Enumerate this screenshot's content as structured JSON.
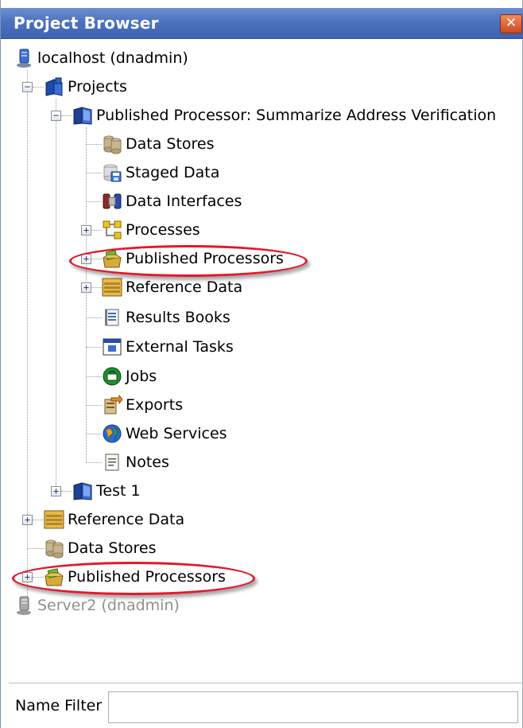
{
  "window": {
    "title": "Project Browser",
    "close_glyph": "✕"
  },
  "tree": {
    "server": "localhost (dnadmin)",
    "projects": "Projects",
    "published_processor": "Published Processor: Summarize Address Verification",
    "data_stores": "Data Stores",
    "staged_data": "Staged Data",
    "data_interfaces": "Data Interfaces",
    "processes": "Processes",
    "published_processors": "Published Processors",
    "reference_data": "Reference Data",
    "results_books": "Results Books",
    "external_tasks": "External Tasks",
    "jobs": "Jobs",
    "exports": "Exports",
    "web_services": "Web Services",
    "notes": "Notes",
    "test1": "Test 1",
    "root_reference_data": "Reference Data",
    "root_data_stores": "Data Stores",
    "root_published_processors": "Published Processors",
    "server2": "Server2 (dnadmin)"
  },
  "filter": {
    "label": "Name Filter",
    "value": "",
    "placeholder": ""
  },
  "colors": {
    "titlebar": "#4d72bf",
    "highlight": "#e2182a",
    "disabled_text": "#8f8f8f"
  },
  "icons": [
    "server-icon",
    "projects-icon",
    "book-icon",
    "database-icon",
    "staged-data-icon",
    "data-interfaces-icon",
    "processes-icon",
    "published-processor-icon",
    "reference-data-icon",
    "results-book-icon",
    "external-tasks-icon",
    "jobs-icon",
    "exports-icon",
    "web-services-icon",
    "notes-icon"
  ]
}
